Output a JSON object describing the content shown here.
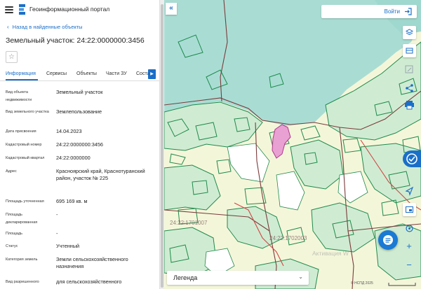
{
  "app": {
    "title": "Геоинформационный портал"
  },
  "navigation": {
    "back_label": "Назад в найденные объекты"
  },
  "object": {
    "title": "Земельный участок: 24:22:0000000:3456",
    "star_glyph": "☆"
  },
  "tabs": [
    {
      "label": "Информация",
      "active": true
    },
    {
      "label": "Сервисы",
      "active": false
    },
    {
      "label": "Объекты",
      "active": false
    },
    {
      "label": "Части ЗУ",
      "active": false
    },
    {
      "label": "Состав",
      "active": false
    }
  ],
  "tabs_scroll_glyph": "▶",
  "attributes": [
    {
      "label": "Вид объекта недвижимости",
      "value": "Земельный участок"
    },
    {
      "label": "Вид земельного участка",
      "value": "Землепользование"
    },
    {
      "label": "Дата присвоения",
      "value": "14.04.2023"
    },
    {
      "label": "Кадастровый номер",
      "value": "24:22:0000000:3456"
    },
    {
      "label": "Кадастровый квартал",
      "value": "24:22:0000000"
    },
    {
      "label": "Адрес",
      "value": "Красноярский край, Краснотуранский район, участок № 225"
    },
    {
      "label": "Площадь уточненная",
      "value": "695 169 кв. м"
    },
    {
      "label": "Площадь декларированная",
      "value": "-"
    },
    {
      "label": "Площадь",
      "value": "-"
    },
    {
      "label": "Статус",
      "value": "Учтенный"
    },
    {
      "label": "Категория земель",
      "value": "Земли сельскохозяйственного назначения"
    },
    {
      "label": "Вид разрешенного",
      "value": "для сельскохозяйственного"
    }
  ],
  "map": {
    "collapse_glyph": "«",
    "login_label": "Войти",
    "legend_label": "Легенда",
    "legend_chevron": "⌄",
    "zoom_in": "+",
    "zoom_out": "−",
    "cadastral_labels": [
      "24:22:1701007",
      "24:22:1702003"
    ],
    "watermark": "Активация W",
    "copyright": "© НСПД 2025",
    "colors": {
      "water": "#a9ddd4",
      "forest": "#cfecd2",
      "field": "#f4f6da",
      "parcel_border": "#1f8a4c",
      "district_border": "#7a3b3b",
      "highlight": "#e8a1d2",
      "accent": "#1a6fc9"
    }
  }
}
